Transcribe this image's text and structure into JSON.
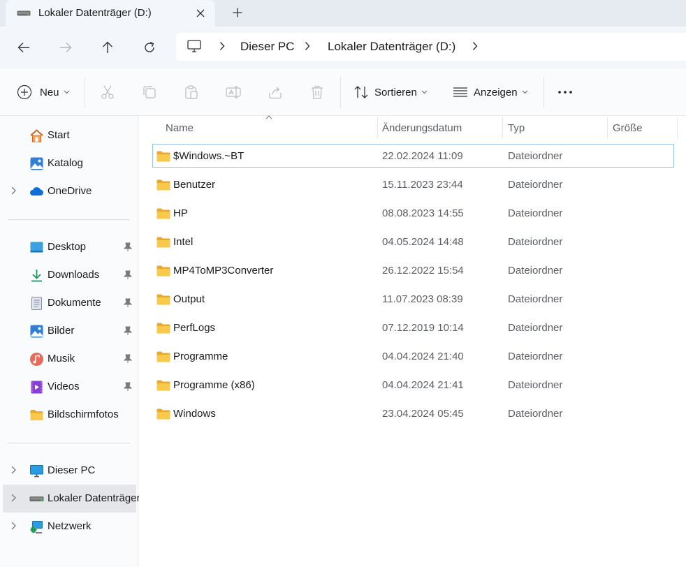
{
  "tab": {
    "title": "Lokaler Datenträger (D:)",
    "close_icon": "close-icon",
    "new_tab_icon": "plus-icon"
  },
  "nav": {
    "back_icon": "arrow-left-icon",
    "forward_icon": "arrow-right-icon",
    "up_icon": "arrow-up-icon",
    "refresh_icon": "refresh-icon",
    "breadcrumbs": [
      "Dieser PC",
      "Lokaler Datenträger (D:)"
    ]
  },
  "toolbar": {
    "new_label": "Neu",
    "sort_label": "Sortieren",
    "view_label": "Anzeigen",
    "more_icon": "more-icon",
    "disabled_actions": [
      "cut-icon",
      "copy-icon",
      "paste-icon",
      "rename-icon",
      "share-icon",
      "delete-icon"
    ]
  },
  "sidebar": {
    "top": [
      {
        "label": "Start",
        "icon": "home-icon",
        "expandable": false
      },
      {
        "label": "Katalog",
        "icon": "gallery-icon",
        "expandable": false
      },
      {
        "label": "OneDrive",
        "icon": "cloud-icon",
        "expandable": true
      }
    ],
    "quick_access": [
      {
        "label": "Desktop",
        "icon": "desktop-icon",
        "pinned": true
      },
      {
        "label": "Downloads",
        "icon": "download-icon",
        "pinned": true
      },
      {
        "label": "Dokumente",
        "icon": "document-icon",
        "pinned": true
      },
      {
        "label": "Bilder",
        "icon": "pictures-icon",
        "pinned": true
      },
      {
        "label": "Musik",
        "icon": "music-icon",
        "pinned": true
      },
      {
        "label": "Videos",
        "icon": "videos-icon",
        "pinned": true
      },
      {
        "label": "Bildschirmfotos",
        "icon": "folder-icon",
        "pinned": false
      }
    ],
    "devices": [
      {
        "label": "Dieser PC",
        "icon": "pc-icon",
        "selected": false
      },
      {
        "label": "Lokaler Datenträger (D:)",
        "icon": "drive-icon",
        "selected": true
      },
      {
        "label": "Netzwerk",
        "icon": "network-icon",
        "selected": false
      }
    ]
  },
  "table": {
    "columns": [
      "Name",
      "Änderungsdatum",
      "Typ",
      "Größe"
    ],
    "rows": [
      {
        "name": "$Windows.~BT",
        "date": "22.02.2024 11:09",
        "type": "Dateiordner",
        "selected": true
      },
      {
        "name": "Benutzer",
        "date": "15.11.2023 23:44",
        "type": "Dateiordner"
      },
      {
        "name": "HP",
        "date": "08.08.2023 14:55",
        "type": "Dateiordner"
      },
      {
        "name": "Intel",
        "date": "04.05.2024 14:48",
        "type": "Dateiordner"
      },
      {
        "name": "MP4ToMP3Converter",
        "date": "26.12.2022 15:54",
        "type": "Dateiordner"
      },
      {
        "name": "Output",
        "date": "11.07.2023 08:39",
        "type": "Dateiordner"
      },
      {
        "name": "PerfLogs",
        "date": "07.12.2019 10:14",
        "type": "Dateiordner"
      },
      {
        "name": "Programme",
        "date": "04.04.2024 21:40",
        "type": "Dateiordner"
      },
      {
        "name": "Programme (x86)",
        "date": "04.04.2024 21:41",
        "type": "Dateiordner"
      },
      {
        "name": "Windows",
        "date": "23.04.2024 05:45",
        "type": "Dateiordner"
      }
    ]
  },
  "colors": {
    "folder": "#f8c94a",
    "accent": "#0067c0",
    "selection_border": "#99c5ea"
  }
}
